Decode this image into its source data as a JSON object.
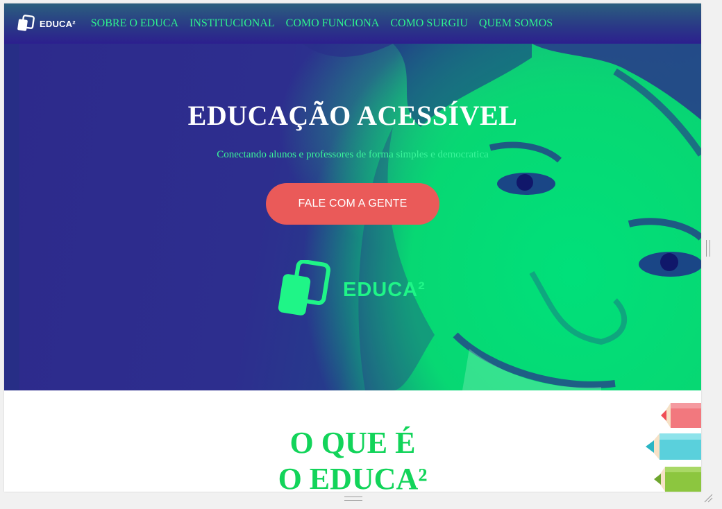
{
  "nav": {
    "brand": "EDUCA²",
    "links": [
      "SOBRE O EDUCA",
      "INSTITUCIONAL",
      "COMO FUNCIONA",
      "COMO SURGIU",
      "QUEM SOMOS"
    ]
  },
  "hero": {
    "title": "EDUCAÇÃO ACESSÍVEL",
    "subtitle": "Conectando alunos e professores de forma simples e democratica",
    "cta_label": "FALE COM A GENTE",
    "logo_text": "EDUCA²"
  },
  "about": {
    "heading_line1": "O QUE É",
    "heading_line2": "O EDUCA²"
  },
  "colors": {
    "nav_bg": "#2a3a86",
    "accent_green": "#2ef28f",
    "cta_red": "#ea5a59",
    "heading_green": "#12d45a",
    "hero_purple": "#2d2a8c"
  },
  "icons": [
    "educa-logo-icon",
    "pencils-illustration",
    "resize-grip-icon"
  ]
}
